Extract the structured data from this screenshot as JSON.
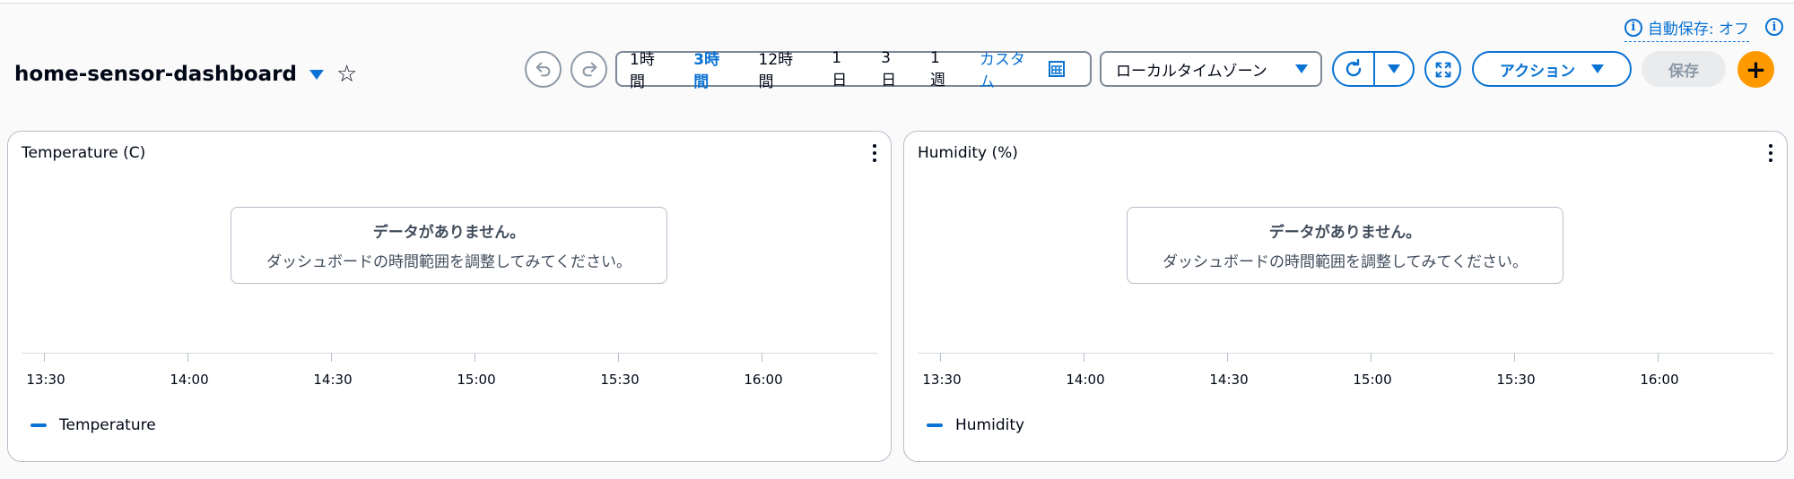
{
  "autosave": {
    "label": "自動保存: オフ"
  },
  "dashboard": {
    "title": "home-sensor-dashboard"
  },
  "time_range": {
    "options": [
      "1時間",
      "3時間",
      "12時間",
      "1日",
      "3日",
      "1週"
    ],
    "active": "3時間",
    "custom_label": "カスタム"
  },
  "timezone": {
    "label": "ローカルタイムゾーン"
  },
  "actions": {
    "label": "アクション"
  },
  "save": {
    "label": "保存"
  },
  "add": {
    "label": "+"
  },
  "widgets": [
    {
      "title": "Temperature (C)",
      "empty_title": "データがありません。",
      "empty_body": "ダッシュボードの時間範囲を調整してみてください。",
      "ticks": [
        "13:30",
        "14:00",
        "14:30",
        "15:00",
        "15:30",
        "16:00"
      ],
      "legend": "Temperature",
      "series_color": "#0972d3"
    },
    {
      "title": "Humidity (%)",
      "empty_title": "データがありません。",
      "empty_body": "ダッシュボードの時間範囲を調整してみてください。",
      "ticks": [
        "13:30",
        "14:00",
        "14:30",
        "15:00",
        "15:30",
        "16:00"
      ],
      "legend": "Humidity",
      "series_color": "#0972d3"
    }
  ]
}
